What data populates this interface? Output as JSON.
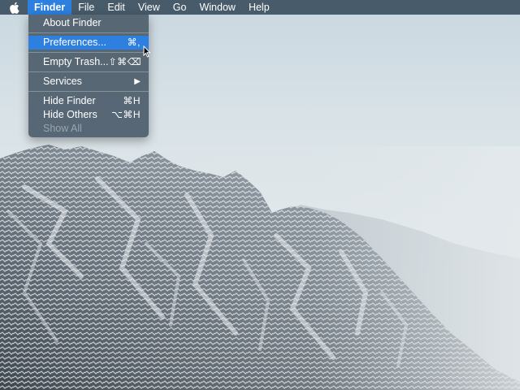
{
  "menubar": {
    "apple_icon": "apple-icon",
    "items": [
      "Finder",
      "File",
      "Edit",
      "View",
      "Go",
      "Window",
      "Help"
    ]
  },
  "finder_menu": {
    "about": {
      "label": "About Finder",
      "shortcut": ""
    },
    "preferences": {
      "label": "Preferences...",
      "shortcut": "⌘,"
    },
    "empty_trash": {
      "label": "Empty Trash...",
      "shortcut": "⇧⌘⌫"
    },
    "services": {
      "label": "Services",
      "shortcut": "▶"
    },
    "hide_finder": {
      "label": "Hide Finder",
      "shortcut": "⌘H"
    },
    "hide_others": {
      "label": "Hide Others",
      "shortcut": "⌥⌘H"
    },
    "show_all": {
      "label": "Show All",
      "shortcut": ""
    }
  },
  "colors": {
    "highlight": "#2d7fe0",
    "menubar": "#3c5060",
    "dropdown": "#4e5e6c",
    "disabled_text": "#9aa6ae"
  }
}
